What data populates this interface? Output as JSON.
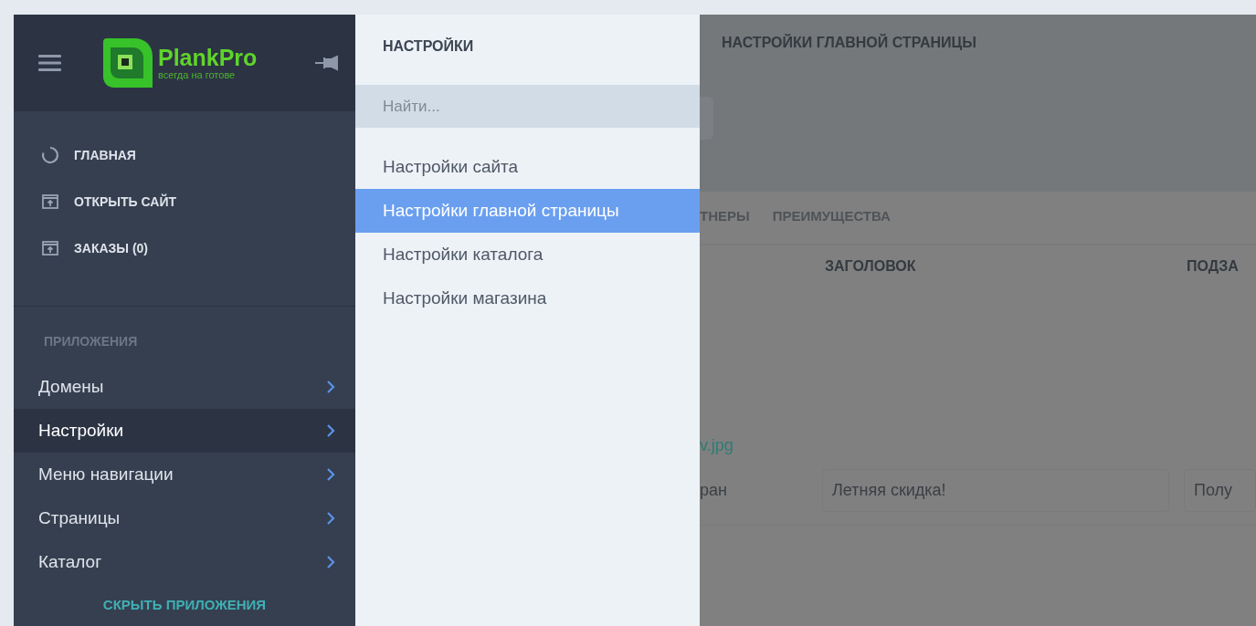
{
  "sidebar": {
    "logo": {
      "name": "PlankPro",
      "tagline": "всегда на готове"
    },
    "nav": [
      {
        "label": "ГЛАВНАЯ",
        "kind": "circle"
      },
      {
        "label": "ОТКРЫТЬ САЙТ",
        "kind": "window"
      },
      {
        "label": "ЗАКАЗЫ (0)",
        "kind": "window"
      }
    ],
    "section_title": "ПРИЛОЖЕНИЯ",
    "apps": [
      {
        "label": "Домены",
        "selected": false
      },
      {
        "label": "Настройки",
        "selected": true
      },
      {
        "label": "Меню навигации",
        "selected": false
      },
      {
        "label": "Страницы",
        "selected": false
      },
      {
        "label": "Каталог",
        "selected": false
      }
    ],
    "hide_link": "СКРЫТЬ ПРИЛОЖЕНИЯ"
  },
  "flyout": {
    "title": "НАСТРОЙКИ",
    "search": {
      "placeholder": "Найти..."
    },
    "items": [
      {
        "label": "Настройки сайта",
        "selected": false
      },
      {
        "label": "Настройки главной страницы",
        "selected": true
      },
      {
        "label": "Настройки каталога",
        "selected": false
      },
      {
        "label": "Настройки магазина",
        "selected": false
      }
    ]
  },
  "main": {
    "breadcrumb": "НАСТРОЙКИ ГЛАВНОЙ СТРАНИЦЫ",
    "tabs": [
      "ТНЕРЫ",
      "ПРЕИМУЩЕСТВА"
    ],
    "columns": [
      "ЗАГОЛОВОК",
      "ПОДЗА"
    ],
    "row": {
      "file_link": "v.jpg",
      "column_1": "ран",
      "title_value": "Летняя скидка!",
      "subtitle_value": "Полу"
    }
  }
}
